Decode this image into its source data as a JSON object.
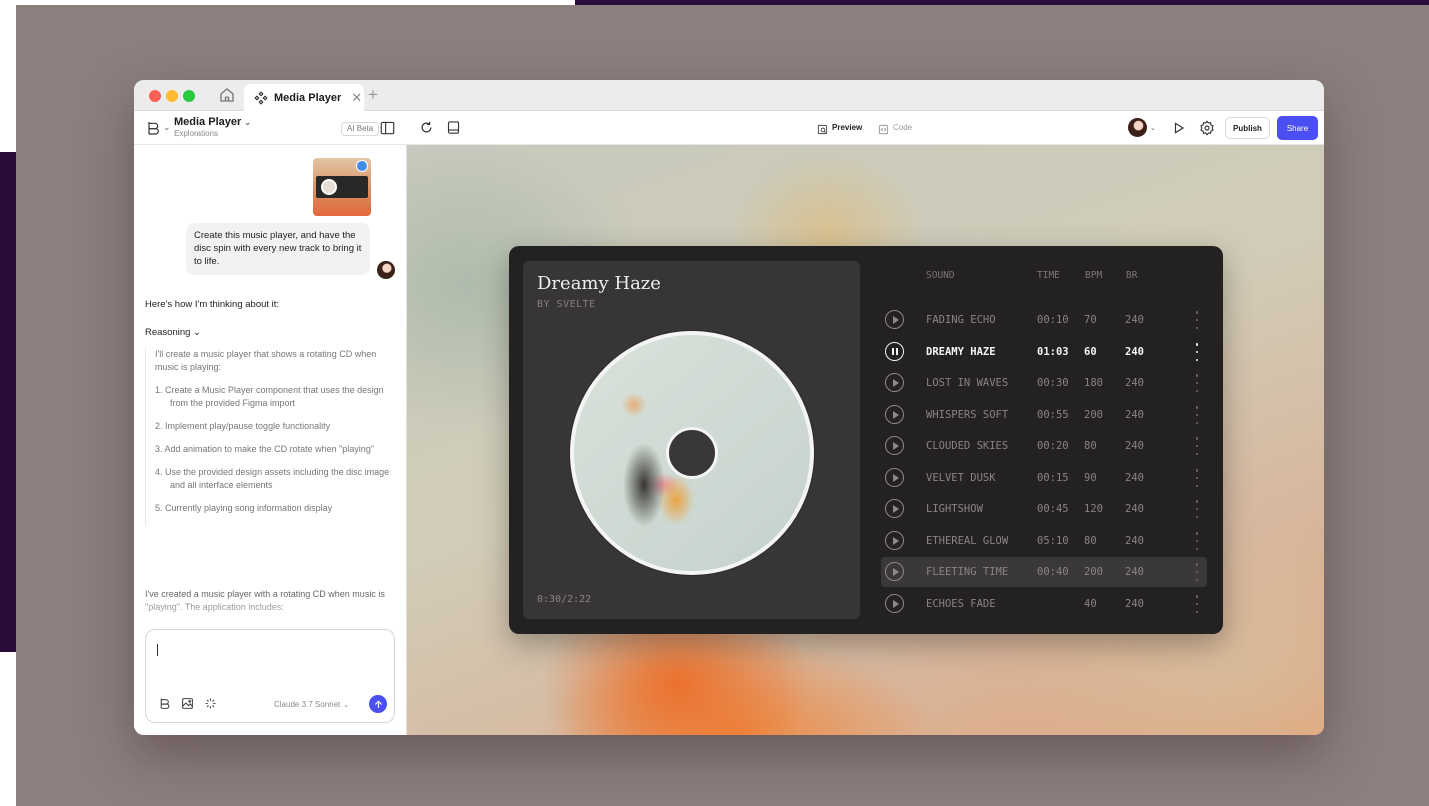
{
  "tab": {
    "title": "Media Player",
    "close": "✕",
    "add": "+"
  },
  "toolbar": {
    "project_name": "Media Player",
    "project_caret": "⌄",
    "project_subtitle": "Explorations",
    "ai_badge": "AI Beta",
    "preview_label": "Preview",
    "code_label": "Code",
    "publish_label": "Publish",
    "share_label": "Share"
  },
  "chat": {
    "user_message": "Create this music player, and have the disc spin with every new track to bring it to life.",
    "assistant_intro": "Here's how I'm thinking about it:",
    "reasoning_label": "Reasoning ⌄",
    "reasoning_text": "I'll create a music player that shows a rotating CD when music is playing:",
    "steps": [
      "1. Create a Music Player component that uses the design from the provided Figma import",
      "2. Implement play/pause toggle functionality",
      "3. Add animation to make the CD rotate when \"playing\"",
      "4. Use the provided design assets including the disc image and all interface elements",
      "5. Currently playing song information display"
    ],
    "summary": "I've created a music player with a rotating CD when music is \"playing\". The application includes:",
    "model": "Claude 3.7 Sonnet",
    "model_caret": "⌄",
    "input_value": ""
  },
  "player": {
    "title": "Dreamy Haze",
    "artist": "BY SVELTE",
    "time": "0:30/2:22",
    "headers": {
      "sound": "SOUND",
      "time": "TIME",
      "bpm": "BPM",
      "br": "BR"
    },
    "tracks": [
      {
        "name": "FADING ECHO",
        "time": "00:10",
        "bpm": "70",
        "br": "240",
        "state": "idle"
      },
      {
        "name": "DREAMY HAZE",
        "time": "01:03",
        "bpm": "60",
        "br": "240",
        "state": "playing"
      },
      {
        "name": "LOST IN WAVES",
        "time": "00:30",
        "bpm": "180",
        "br": "240",
        "state": "idle"
      },
      {
        "name": "WHISPERS SOFT",
        "time": "00:55",
        "bpm": "200",
        "br": "240",
        "state": "idle"
      },
      {
        "name": "CLOUDED SKIES",
        "time": "00:20",
        "bpm": "80",
        "br": "240",
        "state": "idle"
      },
      {
        "name": "VELVET DUSK",
        "time": "00:15",
        "bpm": "90",
        "br": "240",
        "state": "idle"
      },
      {
        "name": "LIGHTSHOW",
        "time": "00:45",
        "bpm": "120",
        "br": "240",
        "state": "idle"
      },
      {
        "name": "ETHEREAL GLOW",
        "time": "05:10",
        "bpm": "80",
        "br": "240",
        "state": "idle"
      },
      {
        "name": "FLEETING TIME",
        "time": "00:40",
        "bpm": "200",
        "br": "240",
        "state": "hover"
      },
      {
        "name": "ECHOES FADE",
        "time": "",
        "bpm": "40",
        "br": "240",
        "state": "idle"
      }
    ]
  },
  "colors": {
    "accent": "#4b4ef0",
    "player_bg": "#232122",
    "card_bg": "#383535",
    "backdrop": "#8c7f7e"
  },
  "icons": {
    "home": "home-icon",
    "tab": "component-icon",
    "refresh": "refresh-icon",
    "device": "device-icon",
    "play": "play-icon",
    "gear": "gear-icon",
    "send": "arrow-up-icon",
    "cursor": "cursor-pointer-icon"
  }
}
